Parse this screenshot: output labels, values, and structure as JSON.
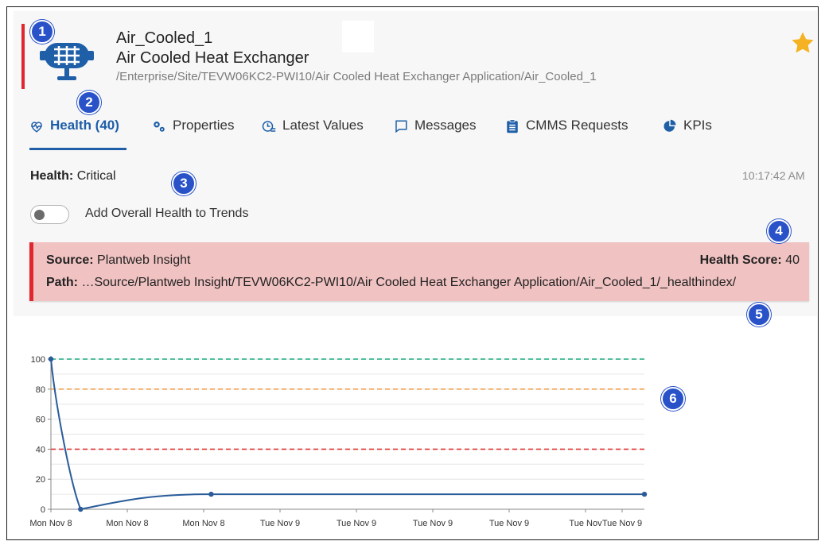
{
  "asset": {
    "name": "Air_Cooled_1",
    "type": "Air Cooled Heat Exchanger",
    "path": "/Enterprise/Site/TEVW06KC2-PWI10/Air Cooled Heat Exchanger Application/Air_Cooled_1",
    "icon": "heat-exchanger-icon",
    "favorite_icon": "star-icon"
  },
  "tabs": [
    {
      "label": "Health (40)",
      "icon": "heartbeat-icon",
      "active": true
    },
    {
      "label": "Properties",
      "icon": "gears-icon",
      "active": false
    },
    {
      "label": "Latest Values",
      "icon": "clock-list-icon",
      "active": false
    },
    {
      "label": "Messages",
      "icon": "message-icon",
      "active": false
    },
    {
      "label": "CMMS Requests",
      "icon": "clipboard-icon",
      "active": false
    },
    {
      "label": "KPIs",
      "icon": "pie-chart-icon",
      "active": false
    }
  ],
  "health": {
    "label": "Health:",
    "value": "Critical",
    "time": "10:17:42 AM"
  },
  "toggle": {
    "label": "Add Overall Health to Trends",
    "on": false
  },
  "alert": {
    "source_label": "Source:",
    "source_value": "Plantweb Insight",
    "score_label": "Health Score:",
    "score_value": "40",
    "path_label": "Path:",
    "path_value": "…Source/Plantweb Insight/TEVW06KC2-PWI10/Air Cooled Heat Exchanger Application/Air_Cooled_1/_healthindex/"
  },
  "callouts": [
    "1",
    "2",
    "3",
    "4",
    "5",
    "6"
  ],
  "colors": {
    "accent_red": "#e0262f",
    "tab_blue": "#1e5fa8",
    "callout_blue": "#2952c8",
    "alert_bg": "#f1c2c2",
    "star": "#f5b323",
    "line_green": "#1aaa7e",
    "line_orange": "#f0a04b",
    "line_red": "#e03b3b",
    "series": "#2a5c9a"
  },
  "chart_data": {
    "type": "line",
    "y_ticks": [
      "100",
      "80",
      "60",
      "40",
      "20",
      "0"
    ],
    "ylim": [
      0,
      100
    ],
    "x_tick_labels": [
      "Mon Nov 8",
      "Mon Nov 8",
      "Mon Nov 8",
      "Tue Nov 9",
      "Tue Nov 9",
      "Tue Nov 9",
      "Tue Nov 9",
      "Tue Nov",
      "Tue Nov 9"
    ],
    "thresholds": [
      {
        "value": 100,
        "color": "#1aaa7e"
      },
      {
        "value": 80,
        "color": "#f0a04b"
      },
      {
        "value": 40,
        "color": "#e03b3b"
      }
    ],
    "series": [
      {
        "points": [
          [
            0,
            100
          ],
          [
            0.05,
            0
          ],
          [
            0.27,
            10
          ],
          [
            1.0,
            10
          ]
        ]
      }
    ],
    "x_domain": [
      0,
      1
    ],
    "grid": true
  }
}
